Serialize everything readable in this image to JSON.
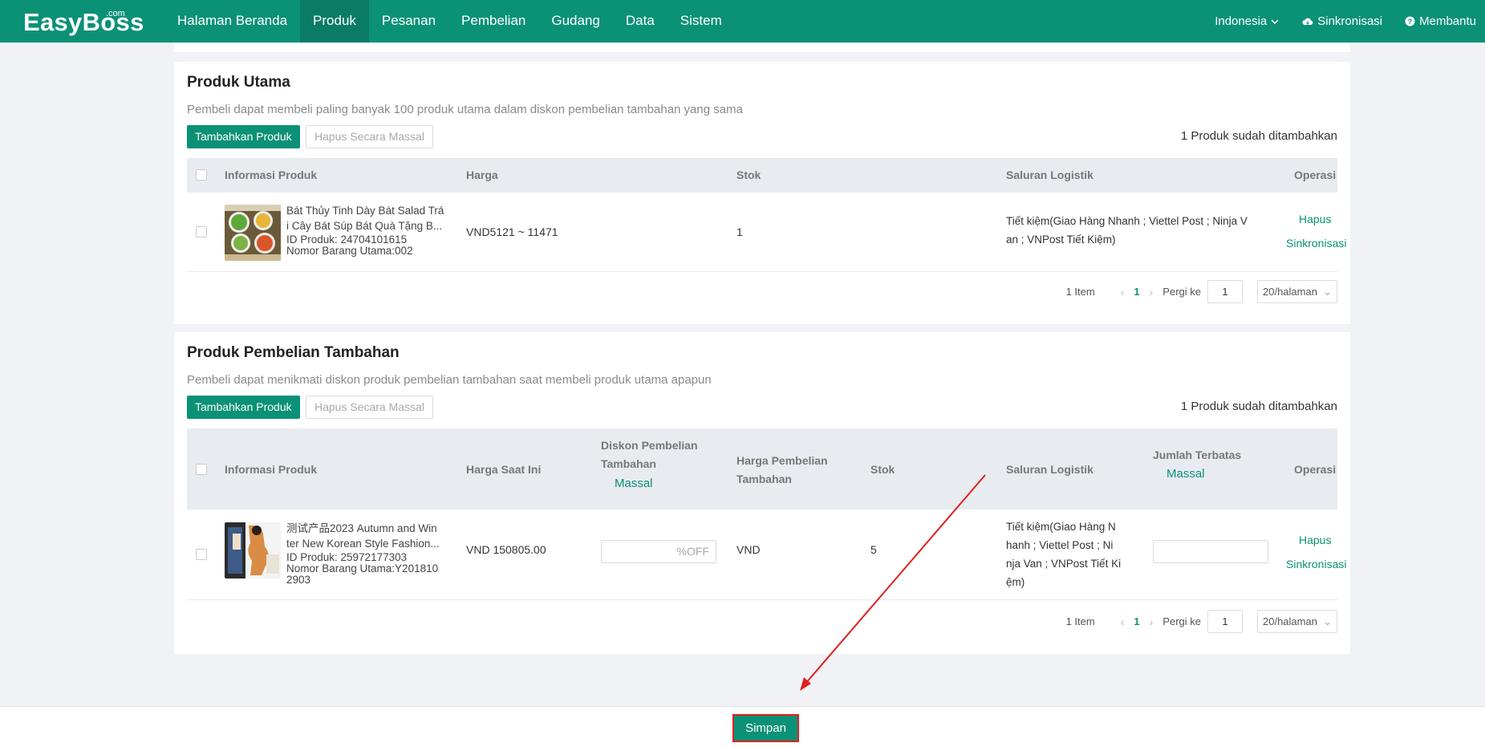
{
  "header": {
    "logo": "EasyBoss",
    "logo_suffix": ".com",
    "nav": [
      "Halaman Beranda",
      "Produk",
      "Pesanan",
      "Pembelian",
      "Gudang",
      "Data",
      "Sistem"
    ],
    "active_nav": "Produk",
    "language": "Indonesia",
    "sync": "Sinkronisasi",
    "help": "Membantu"
  },
  "main_products": {
    "title": "Produk Utama",
    "subtitle": "Pembeli dapat membeli paling banyak 100 produk utama dalam diskon pembelian tambahan yang sama",
    "add_button": "Tambahkan Produk",
    "bulk_delete_button": "Hapus Secara Massal",
    "added_count": "1 Produk sudah ditambahkan",
    "columns": {
      "info": "Informasi Produk",
      "price": "Harga",
      "stock": "Stok",
      "logistics": "Saluran Logistik",
      "operation": "Operasi"
    },
    "rows": [
      {
        "name_line1": "Bát Thủy Tinh Dày Bát Salad Trá",
        "name_line2": "i Cây Bát Súp Bát Quà Tặng B...",
        "product_id": "ID Produk: 24704101615",
        "sku": "Nomor Barang Utama:002",
        "price": "VND5121 ~ 11471",
        "stock": "1",
        "logistics_line1": "Tiết kiệm(Giao Hàng Nhanh ; Viettel Post ; Ninja V",
        "logistics_line2": "an ; VNPost Tiết Kiệm)",
        "op_delete": "Hapus",
        "op_sync": "Sinkronisasi"
      }
    ],
    "pagination": {
      "total": "1 Item",
      "current": "1",
      "goto_label": "Pergi ke",
      "goto_value": "1",
      "page_size": "20/halaman"
    }
  },
  "addon_products": {
    "title": "Produk Pembelian Tambahan",
    "subtitle": "Pembeli dapat menikmati diskon produk pembelian tambahan saat membeli produk utama apapun",
    "add_button": "Tambahkan Produk",
    "bulk_delete_button": "Hapus Secara Massal",
    "added_count": "1 Produk sudah ditambahkan",
    "columns": {
      "info": "Informasi Produk",
      "current_price": "Harga Saat Ini",
      "addon_discount_line1": "Diskon Pembelian",
      "addon_discount_line2": "Tambahan",
      "addon_discount_bulk": "Massal",
      "addon_price_line1": "Harga Pembelian",
      "addon_price_line2": "Tambahan",
      "stock": "Stok",
      "logistics": "Saluran Logistik",
      "limit": "Jumlah Terbatas",
      "limit_bulk": "Massal",
      "operation": "Operasi"
    },
    "rows": [
      {
        "name_line1": "测试产品2023 Autumn and Win",
        "name_line2": "ter New Korean Style Fashion...",
        "product_id": "ID Produk: 25972177303",
        "sku_line1": "Nomor Barang Utama:Y201810",
        "sku_line2": "2903",
        "current_price": "VND 150805.00",
        "discount_suffix": "%OFF",
        "addon_price": "VND",
        "stock": "5",
        "logistics_line1": "Tiết kiệm(Giao Hàng N",
        "logistics_line2": "hanh ; Viettel Post ; Ni",
        "logistics_line3": "nja Van ; VNPost Tiết Ki",
        "logistics_line4": "ệm)",
        "op_delete": "Hapus",
        "op_sync": "Sinkronisasi"
      }
    ],
    "pagination": {
      "total": "1 Item",
      "current": "1",
      "goto_label": "Pergi ke",
      "goto_value": "1",
      "page_size": "20/halaman"
    }
  },
  "footer": {
    "save_button": "Simpan"
  },
  "colors": {
    "brand": "#0b9176",
    "annotation": "#e02020"
  }
}
